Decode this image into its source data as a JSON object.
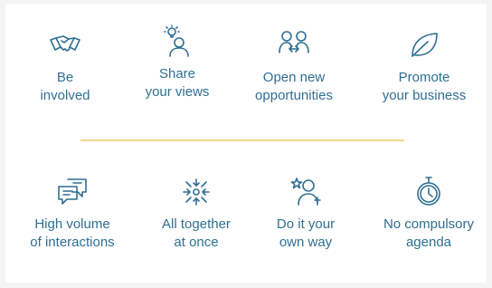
{
  "colors": {
    "icon": "#2f6f93",
    "text": "#2f6f93",
    "divider": "#f1d88a"
  },
  "top_row": [
    {
      "icon": "handshake-icon",
      "label": "Be\ninvolved"
    },
    {
      "icon": "idea-person-icon",
      "label": "Share\nyour views"
    },
    {
      "icon": "linked-people-icon",
      "label": "Open new\nopportunities"
    },
    {
      "icon": "leaf-icon",
      "label": "Promote\nyour business"
    }
  ],
  "bottom_row": [
    {
      "icon": "chat-bubbles-icon",
      "label": "High volume\nof interactions"
    },
    {
      "icon": "converge-arrows-icon",
      "label": "All together\nat once"
    },
    {
      "icon": "person-star-icon",
      "label": "Do it your\nown way"
    },
    {
      "icon": "stopwatch-icon",
      "label": "No compulsory\nagenda"
    }
  ]
}
